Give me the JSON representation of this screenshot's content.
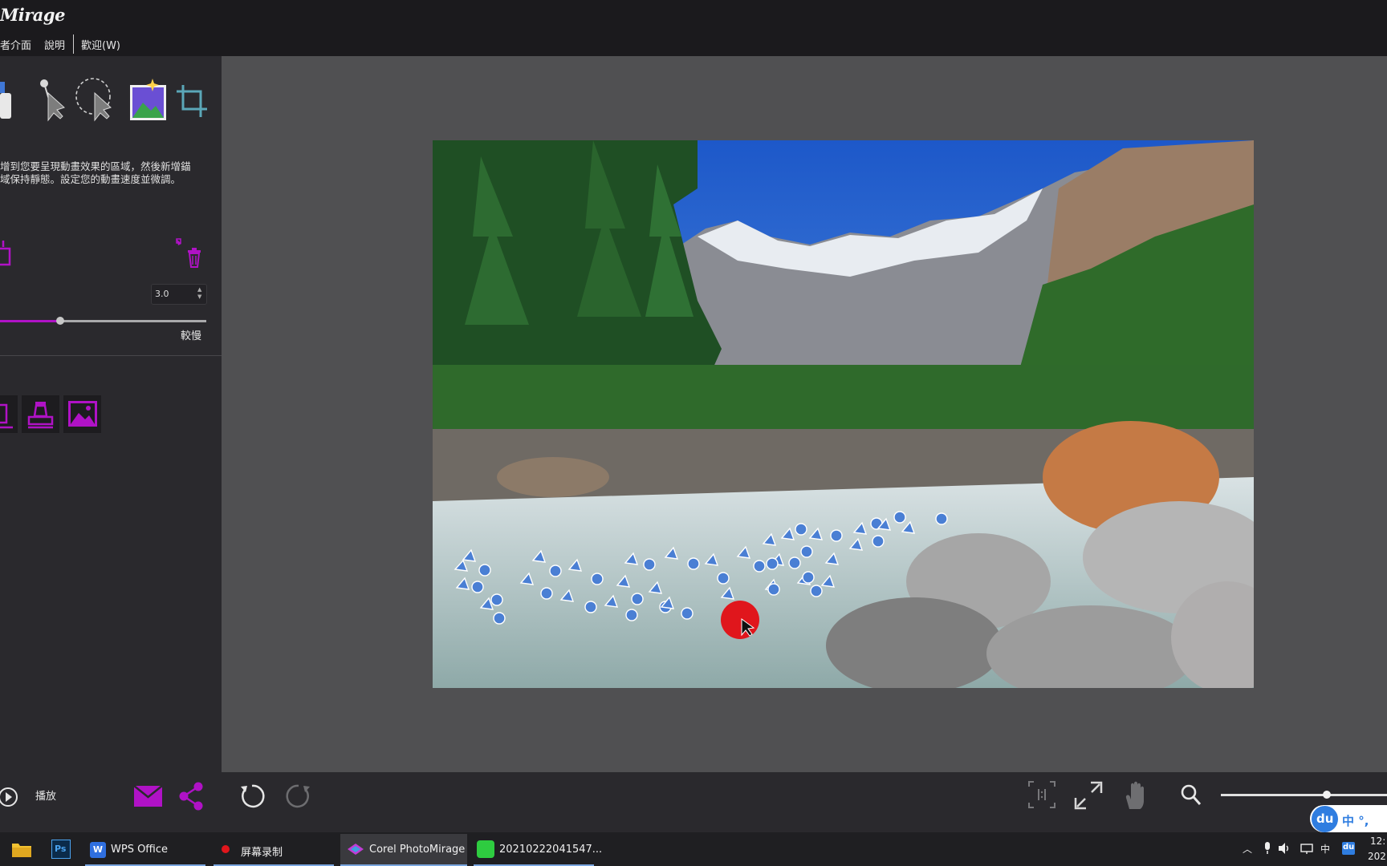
{
  "app": {
    "title": "Mirage"
  },
  "menu": {
    "items": [
      "者介面",
      "說明",
      "歡迎(W)"
    ]
  },
  "panel": {
    "instructions": [
      "增到您要呈現動畫效果的區域，然後新增錨",
      "域保持靜態。設定您的動畫速度並微調。"
    ],
    "speed_value": "3.0",
    "speed_fraction": 0.29,
    "slow_label": "較慢",
    "play_label": "播放"
  },
  "zoom": {
    "fraction": 0.64
  },
  "ime": {
    "logo": "du",
    "text": "中 °,"
  },
  "taskbar": {
    "items": [
      {
        "label": "WPS Office"
      },
      {
        "label": "屏幕录制"
      },
      {
        "label": "Corel PhotoMirage"
      },
      {
        "label": "20210222041547..."
      }
    ],
    "tray": {
      "lang": "中",
      "time": "12:",
      "date": "202"
    }
  },
  "colors": {
    "accent": "#b012c6",
    "anchor": "#4a7fd4",
    "canvas": "#505052",
    "panel": "#2a292d"
  }
}
